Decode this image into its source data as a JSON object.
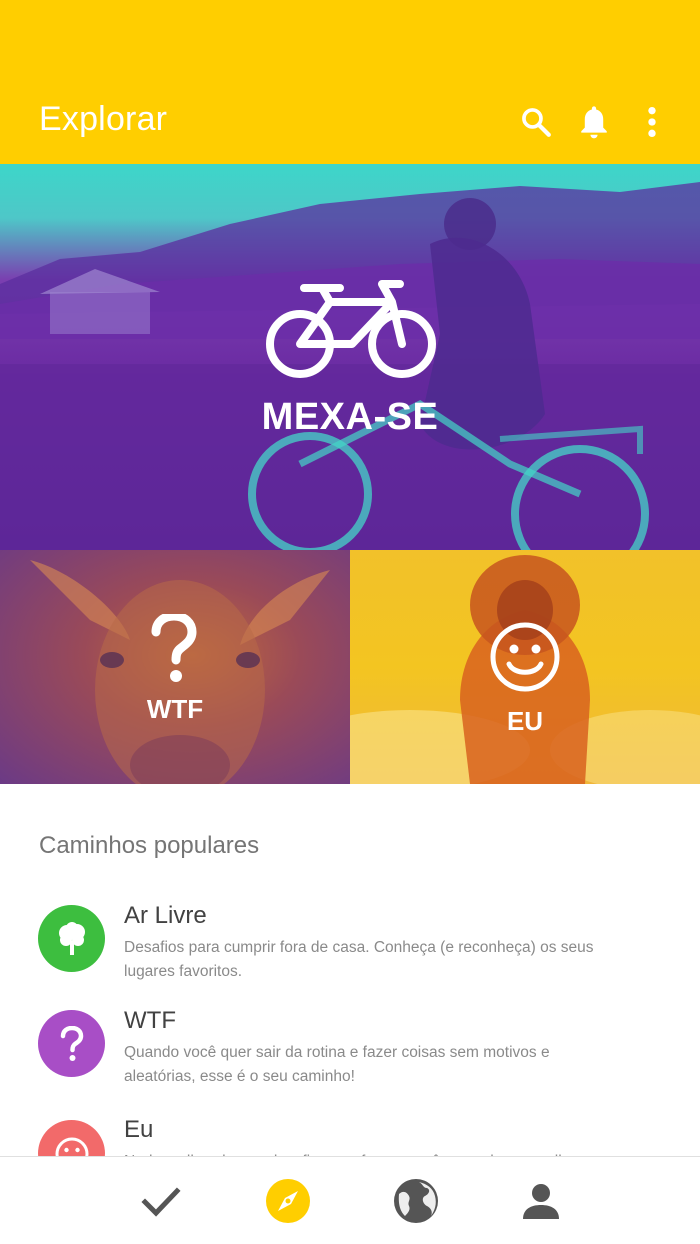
{
  "appbar": {
    "title": "Explorar",
    "actions": [
      "search-icon",
      "bell-icon",
      "more-vert-icon"
    ],
    "color": "#FFCE00"
  },
  "hero": {
    "label": "MEXA-SE",
    "icon": "bicycle-icon"
  },
  "tiles": [
    {
      "label": "WTF",
      "icon": "question-icon"
    },
    {
      "label": "EU",
      "icon": "smiley-icon"
    }
  ],
  "section": {
    "title": "Caminhos populares"
  },
  "paths": [
    {
      "name": "Ar Livre",
      "description": "Desafios para cumprir fora de casa. Conheça (e reconheça) os seus lugares favoritos.",
      "icon": "tree-icon",
      "color": "#3DBE3F"
    },
    {
      "name": "WTF",
      "description": "Quando você quer sair da rotina e fazer coisas sem motivos e aleatórias, esse é o seu caminho!",
      "icon": "question-icon",
      "color": "#A84EC6"
    },
    {
      "name": "Eu",
      "description": "Nada melhor do que desafios que fazem você se conhecer melhor.",
      "icon": "smiley-icon",
      "color": "#F26A6A"
    }
  ],
  "bottom_nav": {
    "items": [
      "check-icon",
      "compass-icon",
      "globe-icon",
      "person-icon"
    ],
    "active": "compass-icon",
    "active_color": "#FFCE00",
    "inactive_color": "#555555"
  }
}
